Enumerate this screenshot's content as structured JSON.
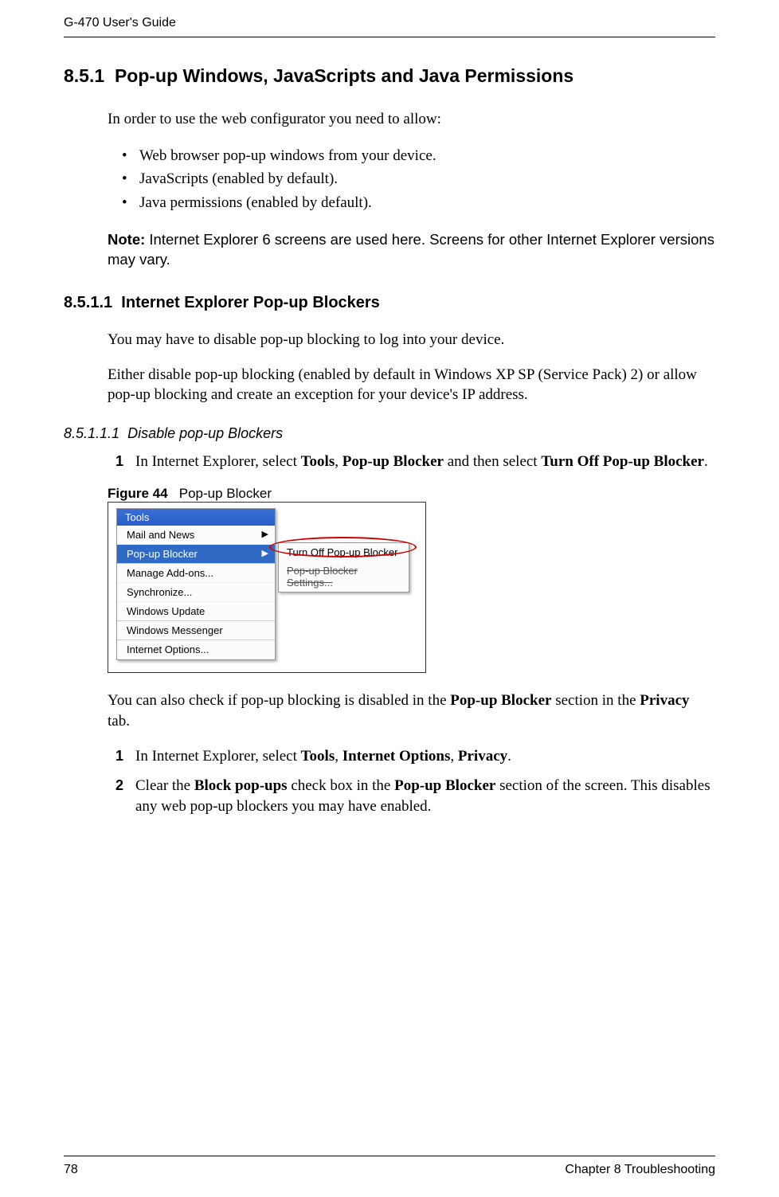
{
  "header": {
    "title": "G-470 User's Guide"
  },
  "footer": {
    "page_num": "78",
    "chapter": "Chapter 8 Troubleshooting"
  },
  "sections": {
    "s1": {
      "num": "8.5.1",
      "title": "Pop-up Windows, JavaScripts and Java Permissions",
      "intro": "In order to use the web configurator you need to allow:",
      "bullets": [
        "Web browser pop-up windows from your device.",
        "JavaScripts (enabled by default).",
        "Java permissions (enabled by default)."
      ],
      "note_label": "Note:",
      "note_text": "Internet Explorer 6 screens are used here. Screens for other Internet Explorer versions may vary."
    },
    "s2": {
      "num": "8.5.1.1",
      "title": "Internet Explorer Pop-up Blockers",
      "p1": "You may have to disable pop-up blocking to log into your device.",
      "p2": "Either disable pop-up blocking (enabled by default in Windows XP SP (Service Pack) 2) or allow pop-up blocking and create an exception for your device's IP address."
    },
    "s3": {
      "num": "8.5.1.1.1",
      "title": "Disable pop-up Blockers",
      "step1_pre": "In Internet Explorer, select ",
      "step1_b1": "Tools",
      "step1_mid1": ", ",
      "step1_b2": "Pop-up Blocker",
      "step1_mid2": " and then select ",
      "step1_b3": "Turn Off Pop-up Blocker",
      "step1_end": "."
    },
    "figure": {
      "label": "Figure 44",
      "caption": "Pop-up Blocker",
      "menu_title": "Tools",
      "menu_items": [
        "Mail and News",
        "Pop-up Blocker",
        "Manage Add-ons...",
        "Synchronize...",
        "Windows Update",
        "Windows Messenger",
        "Internet Options..."
      ],
      "submenu_items": [
        "Turn Off Pop-up Blocker",
        "Pop-up Blocker Settings..."
      ]
    },
    "after_figure": {
      "p_pre": "You can also check if pop-up blocking is disabled in the ",
      "p_b1": "Pop-up Blocker",
      "p_mid": " section in the ",
      "p_b2": "Privacy",
      "p_end": " tab.",
      "step1_pre": "In Internet Explorer, select ",
      "step1_b1": "Tools",
      "step1_c1": ", ",
      "step1_b2": "Internet Options",
      "step1_c2": ", ",
      "step1_b3": "Privacy",
      "step1_end": ".",
      "step2_pre": "Clear the ",
      "step2_b1": "Block pop-ups",
      "step2_mid1": " check box in the ",
      "step2_b2": "Pop-up Blocker",
      "step2_mid2": " section of the screen. This disables any web pop-up blockers you may have enabled."
    }
  }
}
